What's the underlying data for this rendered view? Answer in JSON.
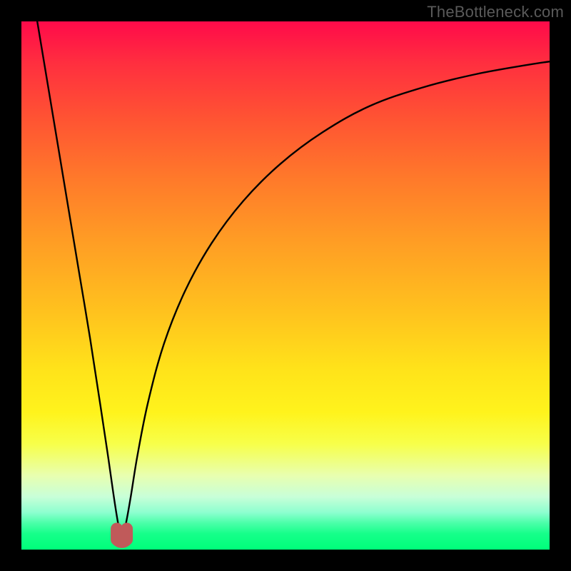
{
  "watermark": {
    "text": "TheBottleneck.com"
  },
  "colors": {
    "frame": "#000000",
    "curve": "#000000",
    "min_marker": "#c05a5a",
    "gradient_top": "#ff0a4a",
    "gradient_bottom": "#00ff7a"
  },
  "chart_data": {
    "type": "line",
    "title": "",
    "xlabel": "",
    "ylabel": "",
    "xlim": [
      0,
      100
    ],
    "ylim": [
      0,
      100
    ],
    "grid": false,
    "legend": false,
    "annotations": [],
    "min_marker": {
      "x": 19,
      "y": 1.5,
      "shape": "u"
    },
    "series": [
      {
        "name": "curve",
        "x": [
          3,
          5,
          7,
          9,
          11,
          13,
          15,
          16.5,
          17.5,
          18.3,
          19,
          19.8,
          20.7,
          22,
          24,
          27,
          31,
          36,
          42,
          49,
          57,
          66,
          76,
          86,
          96,
          100
        ],
        "y": [
          100,
          88,
          76,
          64,
          52,
          40,
          27,
          17,
          10,
          5,
          2,
          5,
          10,
          18,
          28,
          39,
          49,
          58,
          66,
          73,
          79,
          84,
          87.5,
          90,
          91.8,
          92.4
        ]
      }
    ]
  }
}
